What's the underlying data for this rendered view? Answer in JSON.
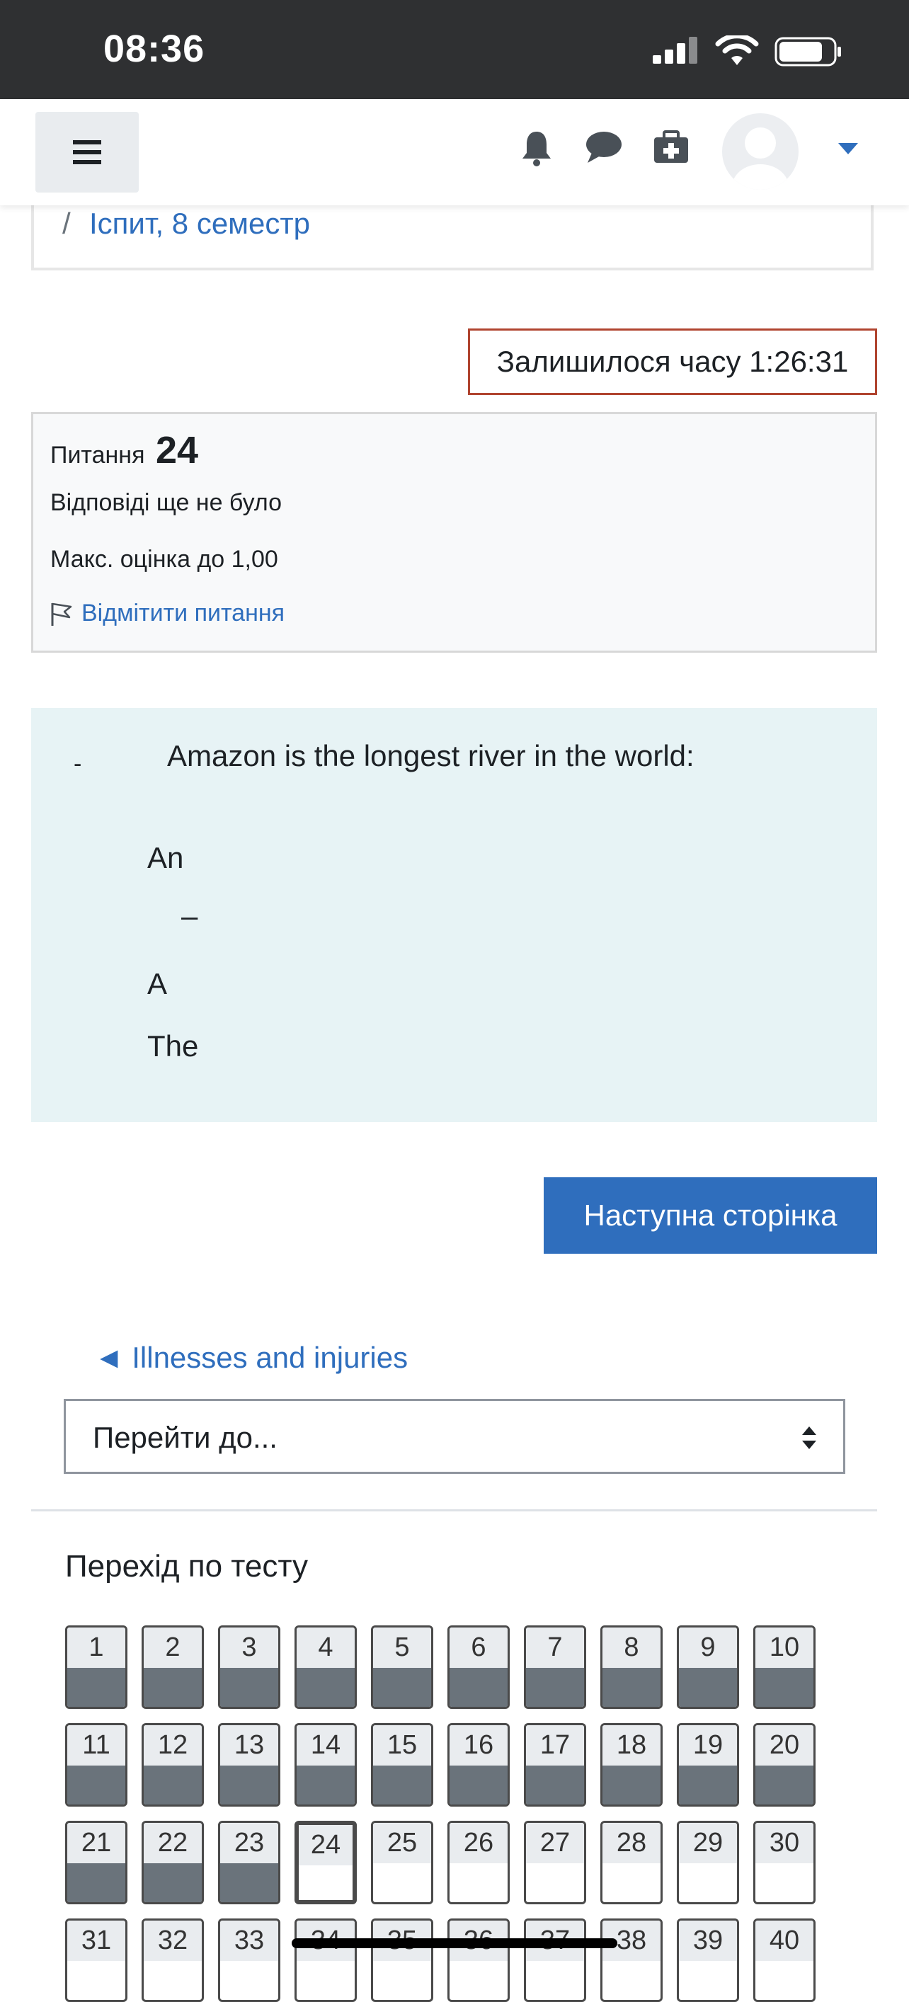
{
  "status_bar": {
    "time": "08:36"
  },
  "breadcrumb": {
    "separator": "/",
    "link": "Іспит, 8 семестр"
  },
  "timer": {
    "text": "Залишилося часу 1:26:31"
  },
  "question_info": {
    "label": "Питання",
    "number": "24",
    "state": "Відповіді ще не було",
    "grade": "Макс. оцінка до 1,00",
    "flag": "Відмітити питання"
  },
  "question": {
    "marker": "-",
    "prompt": "Amazon is the longest river in the world:",
    "options": [
      "An",
      "–",
      "A",
      "The"
    ]
  },
  "next_button": "Наступна сторінка",
  "prev_activity": "◄ Illnesses and injuries",
  "jump_select": {
    "value": "Перейти до..."
  },
  "quiz_nav": {
    "title": "Перехід по тесту",
    "current": 24,
    "answered_through": 23,
    "questions": [
      "1",
      "2",
      "3",
      "4",
      "5",
      "6",
      "7",
      "8",
      "9",
      "10",
      "11",
      "12",
      "13",
      "14",
      "15",
      "16",
      "17",
      "18",
      "19",
      "20",
      "21",
      "22",
      "23",
      "24",
      "25",
      "26",
      "27",
      "28",
      "29",
      "30",
      "31",
      "32",
      "33",
      "34",
      "35",
      "36",
      "37",
      "38",
      "39",
      "40"
    ]
  },
  "colors": {
    "accent": "#2f6ebd",
    "timer_border": "#b0442f",
    "answered": "#6a737b",
    "question_bg": "#e7f3f5"
  }
}
